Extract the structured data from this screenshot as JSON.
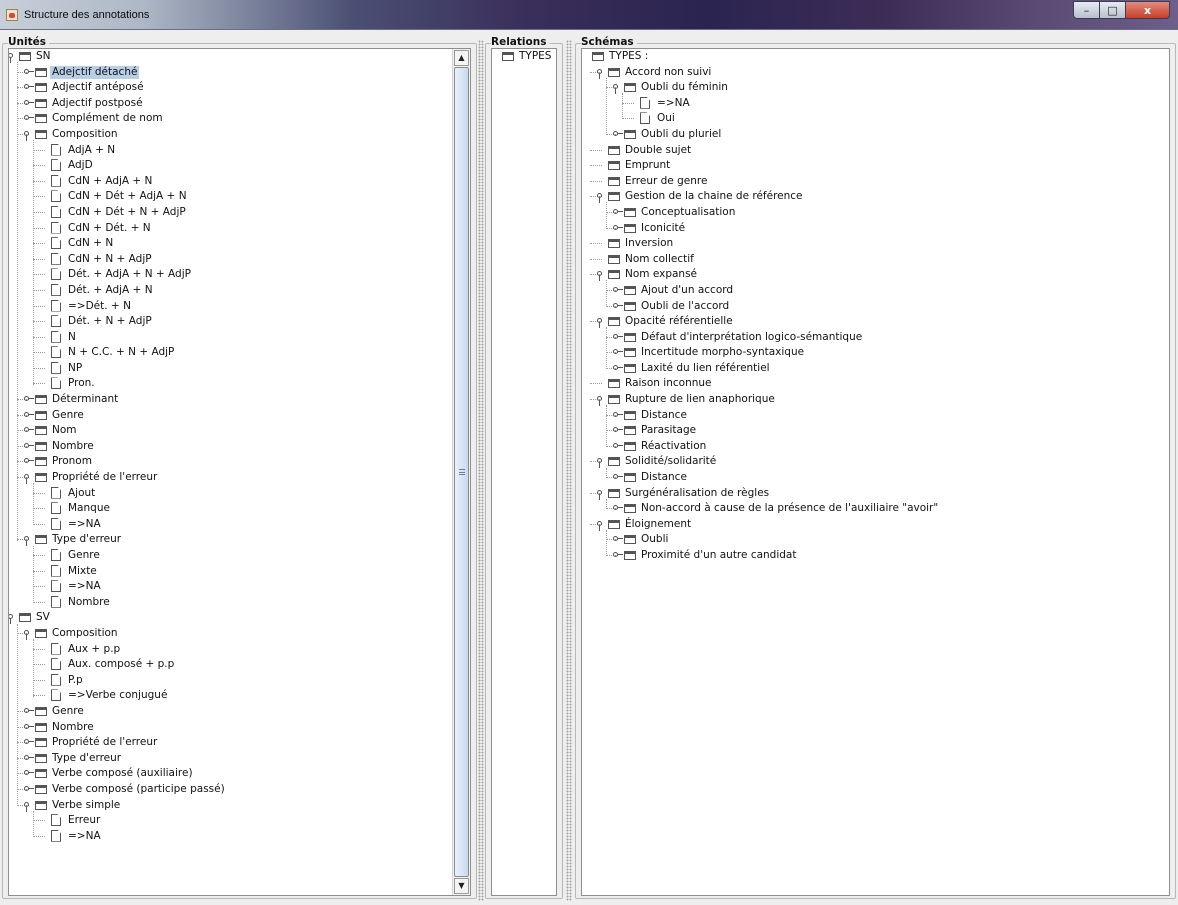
{
  "window": {
    "title": "Structure des annotations",
    "buttons": {
      "minimize": "–",
      "maximize": "□",
      "close": "x"
    }
  },
  "units": {
    "title": "Unités",
    "rows": [
      {
        "label": "SN",
        "depth": 0,
        "kind": "folder",
        "state": "open"
      },
      {
        "label": "Adejctif détaché",
        "depth": 1,
        "kind": "folder",
        "state": "closed",
        "selected": true
      },
      {
        "label": "Adjectif antéposé",
        "depth": 1,
        "kind": "folder",
        "state": "closed"
      },
      {
        "label": "Adjectif postposé",
        "depth": 1,
        "kind": "folder",
        "state": "closed"
      },
      {
        "label": "Complément de nom",
        "depth": 1,
        "kind": "folder",
        "state": "closed"
      },
      {
        "label": "Composition",
        "depth": 1,
        "kind": "folder",
        "state": "open"
      },
      {
        "label": "AdjA + N",
        "depth": 2,
        "kind": "leaf"
      },
      {
        "label": "AdjD",
        "depth": 2,
        "kind": "leaf"
      },
      {
        "label": "CdN + AdjA + N",
        "depth": 2,
        "kind": "leaf"
      },
      {
        "label": "CdN + Dét + AdjA + N",
        "depth": 2,
        "kind": "leaf"
      },
      {
        "label": "CdN + Dét + N + AdjP",
        "depth": 2,
        "kind": "leaf"
      },
      {
        "label": "CdN + Dét. + N",
        "depth": 2,
        "kind": "leaf"
      },
      {
        "label": "CdN + N",
        "depth": 2,
        "kind": "leaf"
      },
      {
        "label": "CdN + N + AdjP",
        "depth": 2,
        "kind": "leaf"
      },
      {
        "label": "Dét. + AdjA +  N + AdjP",
        "depth": 2,
        "kind": "leaf"
      },
      {
        "label": "Dét. + AdjA + N",
        "depth": 2,
        "kind": "leaf"
      },
      {
        "label": "=>Dét. + N",
        "depth": 2,
        "kind": "leaf"
      },
      {
        "label": "Dét. + N + AdjP",
        "depth": 2,
        "kind": "leaf"
      },
      {
        "label": "N",
        "depth": 2,
        "kind": "leaf"
      },
      {
        "label": "N + C.C. + N + AdjP",
        "depth": 2,
        "kind": "leaf"
      },
      {
        "label": "NP",
        "depth": 2,
        "kind": "leaf"
      },
      {
        "label": "Pron.",
        "depth": 2,
        "kind": "leaf"
      },
      {
        "label": "Déterminant",
        "depth": 1,
        "kind": "folder",
        "state": "closed"
      },
      {
        "label": "Genre",
        "depth": 1,
        "kind": "folder",
        "state": "closed"
      },
      {
        "label": "Nom",
        "depth": 1,
        "kind": "folder",
        "state": "closed"
      },
      {
        "label": "Nombre",
        "depth": 1,
        "kind": "folder",
        "state": "closed"
      },
      {
        "label": "Pronom",
        "depth": 1,
        "kind": "folder",
        "state": "closed"
      },
      {
        "label": "Propriété de l'erreur",
        "depth": 1,
        "kind": "folder",
        "state": "open"
      },
      {
        "label": "Ajout",
        "depth": 2,
        "kind": "leaf"
      },
      {
        "label": "Manque",
        "depth": 2,
        "kind": "leaf"
      },
      {
        "label": "=>NA",
        "depth": 2,
        "kind": "leaf"
      },
      {
        "label": "Type d'erreur",
        "depth": 1,
        "kind": "folder",
        "state": "open"
      },
      {
        "label": "Genre",
        "depth": 2,
        "kind": "leaf"
      },
      {
        "label": "Mixte",
        "depth": 2,
        "kind": "leaf"
      },
      {
        "label": "=>NA",
        "depth": 2,
        "kind": "leaf"
      },
      {
        "label": "Nombre",
        "depth": 2,
        "kind": "leaf"
      },
      {
        "label": "SV",
        "depth": 0,
        "kind": "folder",
        "state": "open"
      },
      {
        "label": "Composition",
        "depth": 1,
        "kind": "folder",
        "state": "open"
      },
      {
        "label": "Aux + p.p",
        "depth": 2,
        "kind": "leaf"
      },
      {
        "label": "Aux. composé + p.p",
        "depth": 2,
        "kind": "leaf"
      },
      {
        "label": "P.p",
        "depth": 2,
        "kind": "leaf"
      },
      {
        "label": "=>Verbe conjugué",
        "depth": 2,
        "kind": "leaf"
      },
      {
        "label": "Genre",
        "depth": 1,
        "kind": "folder",
        "state": "closed"
      },
      {
        "label": "Nombre",
        "depth": 1,
        "kind": "folder",
        "state": "closed"
      },
      {
        "label": "Propriété de l'erreur",
        "depth": 1,
        "kind": "folder",
        "state": "closed"
      },
      {
        "label": "Type d'erreur",
        "depth": 1,
        "kind": "folder",
        "state": "closed"
      },
      {
        "label": "Verbe composé (auxiliaire)",
        "depth": 1,
        "kind": "folder",
        "state": "closed"
      },
      {
        "label": "Verbe composé (participe passé)",
        "depth": 1,
        "kind": "folder",
        "state": "closed"
      },
      {
        "label": "Verbe simple",
        "depth": 1,
        "kind": "folder",
        "state": "open"
      },
      {
        "label": "Erreur",
        "depth": 2,
        "kind": "leaf"
      },
      {
        "label": "=>NA",
        "depth": 2,
        "kind": "leaf"
      }
    ],
    "scroll_position": 0.0
  },
  "relations": {
    "title": "Relations",
    "rows": [
      {
        "label": "TYPES :",
        "depth": 0,
        "kind": "folder"
      }
    ]
  },
  "schemas": {
    "title": "Schémas",
    "rows": [
      {
        "label": "TYPES :",
        "depth": 0,
        "kind": "folder"
      },
      {
        "label": "Accord non suivi",
        "depth": 1,
        "kind": "folder",
        "state": "open"
      },
      {
        "label": "Oubli du féminin",
        "depth": 2,
        "kind": "folder",
        "state": "open"
      },
      {
        "label": "=>NA",
        "depth": 3,
        "kind": "leaf"
      },
      {
        "label": "Oui",
        "depth": 3,
        "kind": "leaf"
      },
      {
        "label": "Oubli du pluriel",
        "depth": 2,
        "kind": "folder",
        "state": "closed"
      },
      {
        "label": "Double sujet",
        "depth": 1,
        "kind": "folder"
      },
      {
        "label": "Emprunt",
        "depth": 1,
        "kind": "folder"
      },
      {
        "label": "Erreur de genre",
        "depth": 1,
        "kind": "folder"
      },
      {
        "label": "Gestion de la chaine de référence",
        "depth": 1,
        "kind": "folder",
        "state": "open"
      },
      {
        "label": "Conceptualisation",
        "depth": 2,
        "kind": "folder",
        "state": "closed"
      },
      {
        "label": "Iconicité",
        "depth": 2,
        "kind": "folder",
        "state": "closed"
      },
      {
        "label": "Inversion",
        "depth": 1,
        "kind": "folder"
      },
      {
        "label": "Nom collectif",
        "depth": 1,
        "kind": "folder"
      },
      {
        "label": "Nom expansé",
        "depth": 1,
        "kind": "folder",
        "state": "open"
      },
      {
        "label": "Ajout d'un accord",
        "depth": 2,
        "kind": "folder",
        "state": "closed"
      },
      {
        "label": "Oubli de l'accord",
        "depth": 2,
        "kind": "folder",
        "state": "closed"
      },
      {
        "label": "Opacité référentielle",
        "depth": 1,
        "kind": "folder",
        "state": "open"
      },
      {
        "label": "Défaut d'interprétation logico-sémantique",
        "depth": 2,
        "kind": "folder",
        "state": "closed"
      },
      {
        "label": "Incertitude morpho-syntaxique",
        "depth": 2,
        "kind": "folder",
        "state": "closed"
      },
      {
        "label": "Laxité du lien référentiel",
        "depth": 2,
        "kind": "folder",
        "state": "closed"
      },
      {
        "label": "Raison inconnue",
        "depth": 1,
        "kind": "folder"
      },
      {
        "label": "Rupture de lien anaphorique",
        "depth": 1,
        "kind": "folder",
        "state": "open"
      },
      {
        "label": "Distance",
        "depth": 2,
        "kind": "folder",
        "state": "closed"
      },
      {
        "label": "Parasitage",
        "depth": 2,
        "kind": "folder",
        "state": "closed"
      },
      {
        "label": "Réactivation",
        "depth": 2,
        "kind": "folder",
        "state": "closed"
      },
      {
        "label": "Solidité/solidarité",
        "depth": 1,
        "kind": "folder",
        "state": "open"
      },
      {
        "label": "Distance",
        "depth": 2,
        "kind": "folder",
        "state": "closed"
      },
      {
        "label": "Surgénéralisation de règles",
        "depth": 1,
        "kind": "folder",
        "state": "open"
      },
      {
        "label": "Non-accord à cause de la présence de l'auxiliaire \"avoir\"",
        "depth": 2,
        "kind": "folder",
        "state": "closed"
      },
      {
        "label": "Éloignement",
        "depth": 1,
        "kind": "folder",
        "state": "open"
      },
      {
        "label": "Oubli",
        "depth": 2,
        "kind": "folder",
        "state": "closed"
      },
      {
        "label": "Proximité d'un autre candidat",
        "depth": 2,
        "kind": "folder",
        "state": "closed"
      }
    ]
  },
  "colors": {
    "selection": "#b8cfe5",
    "tree_background": "#ffffff",
    "panel_background": "#eeeeee"
  }
}
